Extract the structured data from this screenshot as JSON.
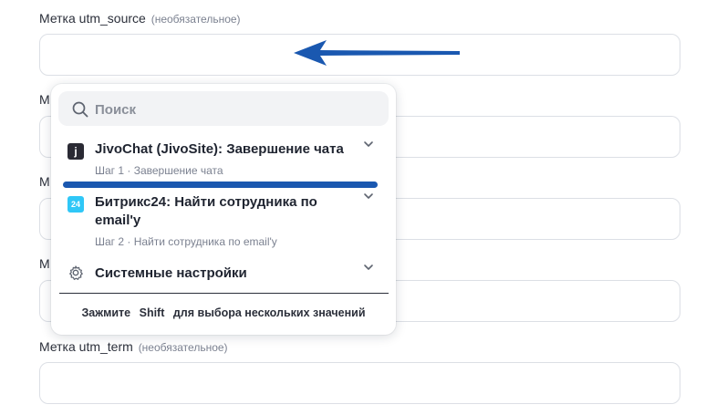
{
  "form": {
    "utm_source": {
      "label": "Метка utm_source",
      "optional": "(необязательное)"
    },
    "stub_label": "М",
    "utm_term": {
      "label": "Метка utm_term",
      "optional": "(необязательное)"
    }
  },
  "dropdown": {
    "search": {
      "placeholder": "Поиск",
      "value": ""
    },
    "items": [
      {
        "icon": "jivochat-app-icon",
        "icon_text": "j",
        "icon_color": "#2a2a34",
        "title": "JivoChat (JivoSite): Завершение чата",
        "subtitle": "Шаг 1 · Завершение чата"
      },
      {
        "icon": "bitrix24-app-icon",
        "icon_text": "24",
        "icon_color": "#2fc7f7",
        "title": "Битрикс24: Найти сотрудника по email'у",
        "subtitle": "Шаг 2 · Найти сотрудника по email'у"
      },
      {
        "icon": "gear-icon",
        "title": "Системные настройки"
      }
    ],
    "footer": {
      "prefix": "Зажмите",
      "key": "Shift",
      "suffix": "для выбора нескольких значений"
    }
  },
  "colors": {
    "annotation_blue": "#1a58b0"
  }
}
